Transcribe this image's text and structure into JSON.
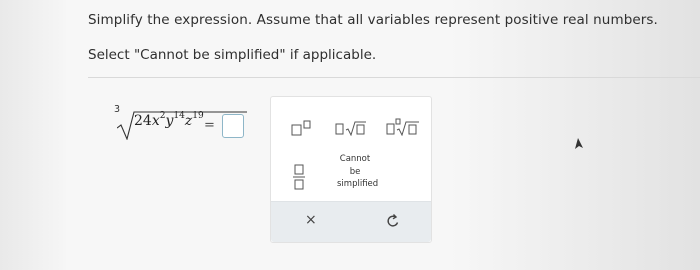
{
  "question": {
    "line1": "Simplify the expression. Assume that all variables represent positive real numbers.",
    "line2": "Select \"Cannot be simplified\" if applicable."
  },
  "expression": {
    "index": "3",
    "coefficient": "24",
    "var_x": "x",
    "exp_x": "2",
    "var_y": "y",
    "exp_y": "14",
    "var_z": "z",
    "exp_z": "19",
    "equals": "="
  },
  "palette": {
    "buttons": [
      "exponent-icon",
      "sqrt-icon",
      "nth-root-icon",
      "fraction-icon"
    ],
    "cannot_line1": "Cannot",
    "cannot_line2": "be",
    "cannot_line3": "simplified",
    "clear_label": "×",
    "reset_icon": "redo-icon"
  },
  "colors": {
    "answer_box_border": "#8eb6c8",
    "palette_bar": "#e8ecef"
  }
}
